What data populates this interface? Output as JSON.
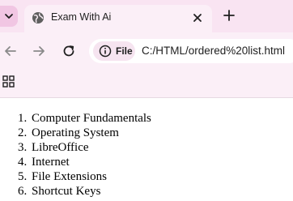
{
  "browser": {
    "tab": {
      "title": "Exam With Ai"
    },
    "address_bar": {
      "site_chip_label": "File",
      "url": "C:/HTML/ordered%20list.html"
    },
    "icons": {
      "tab_dropdown": "chevron-down-icon",
      "favicon": "globe-icon",
      "close": "close-icon",
      "new_tab": "plus-icon",
      "back": "back-arrow-icon",
      "forward": "forward-arrow-icon",
      "reload": "reload-icon",
      "info": "info-icon",
      "apps": "apps-grid-icon"
    },
    "colors": {
      "tabbar": "#f9e4f2",
      "toolbar": "#fbeff7",
      "chip": "#f6e4f0"
    }
  },
  "page": {
    "list": [
      {
        "number": "1.",
        "text": "Computer Fundamentals"
      },
      {
        "number": "2.",
        "text": "Operating System"
      },
      {
        "number": "3.",
        "text": "LibreOffice"
      },
      {
        "number": "4.",
        "text": "Internet"
      },
      {
        "number": "5.",
        "text": "File Extensions"
      },
      {
        "number": "6.",
        "text": "Shortcut Keys"
      }
    ]
  }
}
